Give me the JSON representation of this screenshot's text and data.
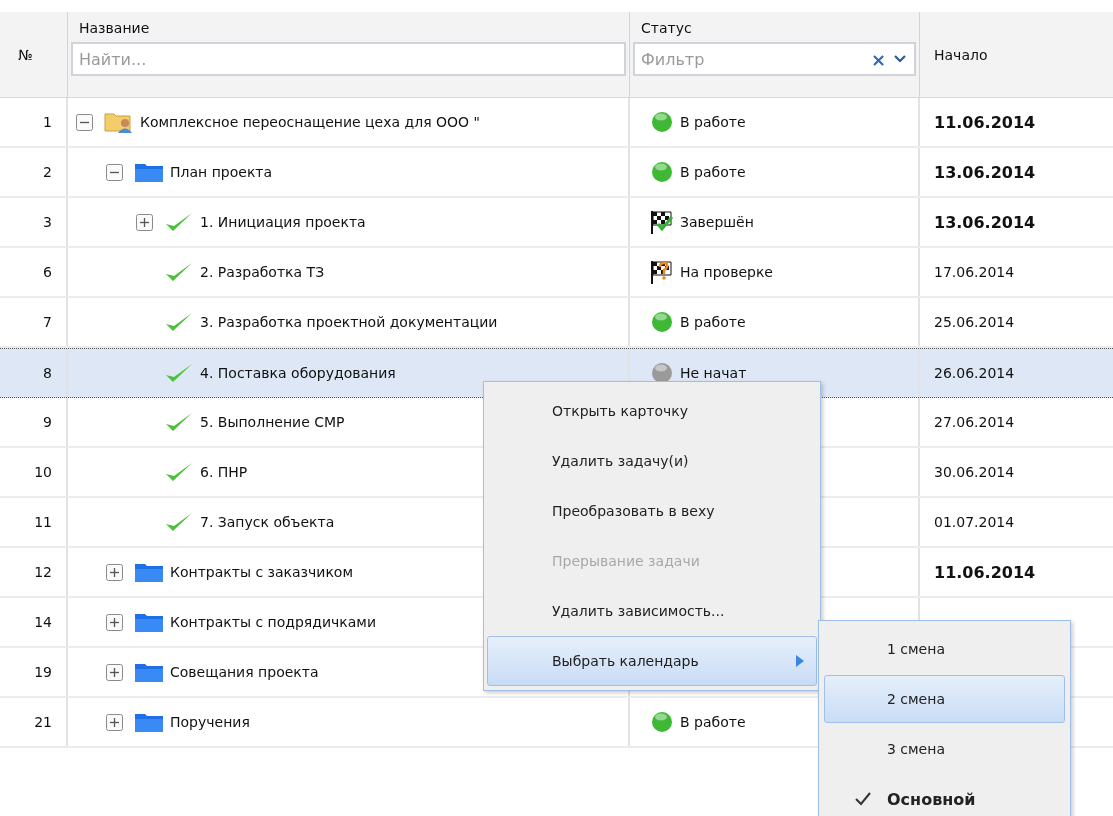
{
  "header": {
    "number": "№",
    "name": "Название",
    "status": "Статус",
    "start": "Начало",
    "search": {
      "placeholder": "Найти..."
    },
    "filter": {
      "placeholder": "Фильтр",
      "clear": "×"
    }
  },
  "rows": [
    {
      "number": "1",
      "name": "Комплексное переоснащение цеха для ООО \"",
      "kind": "project",
      "expanded": true,
      "selected": false,
      "summary": true,
      "status": {
        "kind": "in_progress",
        "label": "В работе"
      },
      "start": "11.06.2014",
      "children": [
        {
          "number": "2",
          "name": "План проекта",
          "kind": "folder",
          "expanded": true,
          "selected": false,
          "summary": true,
          "status": {
            "kind": "in_progress",
            "label": "В работе"
          },
          "start": "13.06.2014",
          "children": [
            {
              "number": "3",
              "name": "1. Инициация проекта",
              "kind": "task",
              "expanded": false,
              "selected": false,
              "summary": true,
              "status": {
                "kind": "done",
                "label": "Завершён"
              },
              "start": "13.06.2014"
            },
            {
              "number": "6",
              "name": "2. Разработка ТЗ",
              "kind": "task",
              "selected": false,
              "summary": false,
              "status": {
                "kind": "review",
                "label": "На проверке"
              },
              "start": "17.06.2014"
            },
            {
              "number": "7",
              "name": "3. Разработка проектной документации",
              "kind": "task",
              "selected": false,
              "summary": false,
              "status": {
                "kind": "in_progress",
                "label": "В работе"
              },
              "start": "25.06.2014"
            },
            {
              "number": "8",
              "name": "4. Поставка оборудования",
              "kind": "task",
              "selected": true,
              "summary": false,
              "status": {
                "kind": "not_started",
                "label": "Не начат"
              },
              "start": "26.06.2014"
            },
            {
              "number": "9",
              "name": "5. Выполнение СМР",
              "kind": "task",
              "selected": false,
              "summary": false,
              "start": "27.06.2014"
            },
            {
              "number": "10",
              "name": "6. ПНР",
              "kind": "task",
              "selected": false,
              "summary": false,
              "start": "30.06.2014"
            },
            {
              "number": "11",
              "name": "7. Запуск объекта",
              "kind": "task",
              "selected": false,
              "summary": false,
              "start": "01.07.2014"
            }
          ]
        },
        {
          "number": "12",
          "name": "Контракты с заказчиком",
          "kind": "folder",
          "expanded": false,
          "selected": false,
          "summary": true,
          "start": "11.06.2014"
        },
        {
          "number": "14",
          "name": "Контракты с подрядичками",
          "kind": "folder",
          "expanded": false,
          "selected": false
        },
        {
          "number": "19",
          "name": "Совещания проекта",
          "kind": "folder",
          "expanded": false,
          "selected": false
        },
        {
          "number": "21",
          "name": "Поручения",
          "kind": "folder",
          "expanded": false,
          "selected": false,
          "status": {
            "kind": "in_progress",
            "label": "В работе"
          }
        }
      ]
    }
  ],
  "context_menu": {
    "items": [
      {
        "label": "Открыть карточку",
        "disabled": false,
        "selected": false
      },
      {
        "label": "Удалить задачу(и)",
        "disabled": false,
        "selected": false
      },
      {
        "label": "Преобразовать в веху",
        "disabled": false,
        "selected": false
      },
      {
        "label": "Прерывание задачи",
        "disabled": true,
        "selected": false
      },
      {
        "label": "Удалить зависимость...",
        "disabled": false,
        "selected": false
      },
      {
        "label": "Выбрать календарь",
        "disabled": false,
        "selected": true,
        "submenu": true
      }
    ]
  },
  "submenu": {
    "items": [
      {
        "label": "1 смена",
        "selected": false,
        "checked": false
      },
      {
        "label": "2 смена",
        "selected": true,
        "checked": false
      },
      {
        "label": "3 смена",
        "selected": false,
        "checked": false
      },
      {
        "label": "Основной",
        "selected": false,
        "checked": true
      }
    ]
  }
}
